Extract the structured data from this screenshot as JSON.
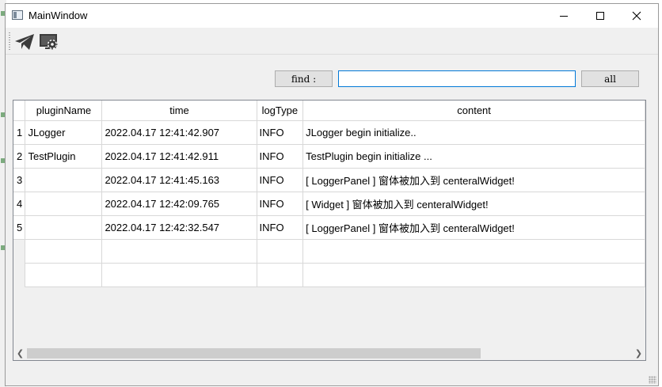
{
  "window": {
    "title": "MainWindow"
  },
  "toolbar": {
    "tools": [
      {
        "name": "send",
        "icon": "paper-plane-icon"
      },
      {
        "name": "settings",
        "icon": "settings-monitor-icon"
      }
    ]
  },
  "search": {
    "find_label": "find :",
    "value": "",
    "all_label": "all"
  },
  "table": {
    "headers": [
      "pluginName",
      "time",
      "logType",
      "content"
    ],
    "rows": [
      {
        "num": "1",
        "plugin": "JLogger",
        "time": "2022.04.17 12:41:42.907",
        "type": "INFO",
        "content": "JLogger begin initialize.."
      },
      {
        "num": "2",
        "plugin": "TestPlugin",
        "time": "2022.04.17 12:41:42.911",
        "type": "INFO",
        "content": "TestPlugin begin initialize ..."
      },
      {
        "num": "3",
        "plugin": "",
        "time": "2022.04.17 12:41:45.163",
        "type": "INFO",
        "content": "[ LoggerPanel ] 窗体被加入到 centeralWidget!"
      },
      {
        "num": "4",
        "plugin": "",
        "time": "2022.04.17 12:42:09.765",
        "type": "INFO",
        "content": "[ Widget ] 窗体被加入到 centeralWidget!"
      },
      {
        "num": "5",
        "plugin": "",
        "time": "2022.04.17 12:42:32.547",
        "type": "INFO",
        "content": "[ LoggerPanel ] 窗体被加入到 centeralWidget!"
      }
    ]
  },
  "colors": {
    "accent": "#0078d7",
    "icon": "#3c3c3c"
  }
}
